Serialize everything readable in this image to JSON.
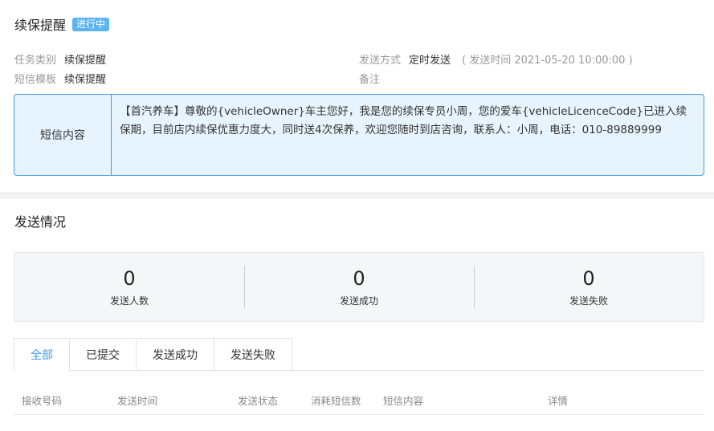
{
  "header": {
    "title": "续保提醒",
    "status": "进行中"
  },
  "info": {
    "task_type_label": "任务类别",
    "task_type_value": "续保提醒",
    "template_label": "短信模板",
    "template_value": "续保提醒",
    "send_method_label": "发送方式",
    "send_method_value": "定时发送",
    "send_time_text": "( 发送时间 2021-05-20 10:00:00 )",
    "remark_label": "备注"
  },
  "sms": {
    "label": "短信内容",
    "content": "【首汽养车】尊敬的{vehicleOwner}车主您好，我是您的续保专员小周，您的爱车{vehicleLicenceCode}已进入续保期，目前店内续保优惠力度大，同时送4次保养，欢迎您随时到店咨询，联系人：小周，电话：010-89889999"
  },
  "send_section": {
    "title": "发送情况",
    "stats": [
      {
        "value": "0",
        "label": "发送人数"
      },
      {
        "value": "0",
        "label": "发送成功"
      },
      {
        "value": "0",
        "label": "发送失败"
      }
    ]
  },
  "tabs": [
    {
      "label": "全部"
    },
    {
      "label": "已提交"
    },
    {
      "label": "发送成功"
    },
    {
      "label": "发送失败"
    }
  ],
  "table": {
    "columns": [
      "接收号码",
      "发送时间",
      "发送状态",
      "消耗短信数",
      "短信内容",
      "详情"
    ]
  },
  "colors": {
    "accent": "#3d9be9",
    "badge": "#5ab4f0",
    "sms_bg": "#e8f4fd"
  }
}
